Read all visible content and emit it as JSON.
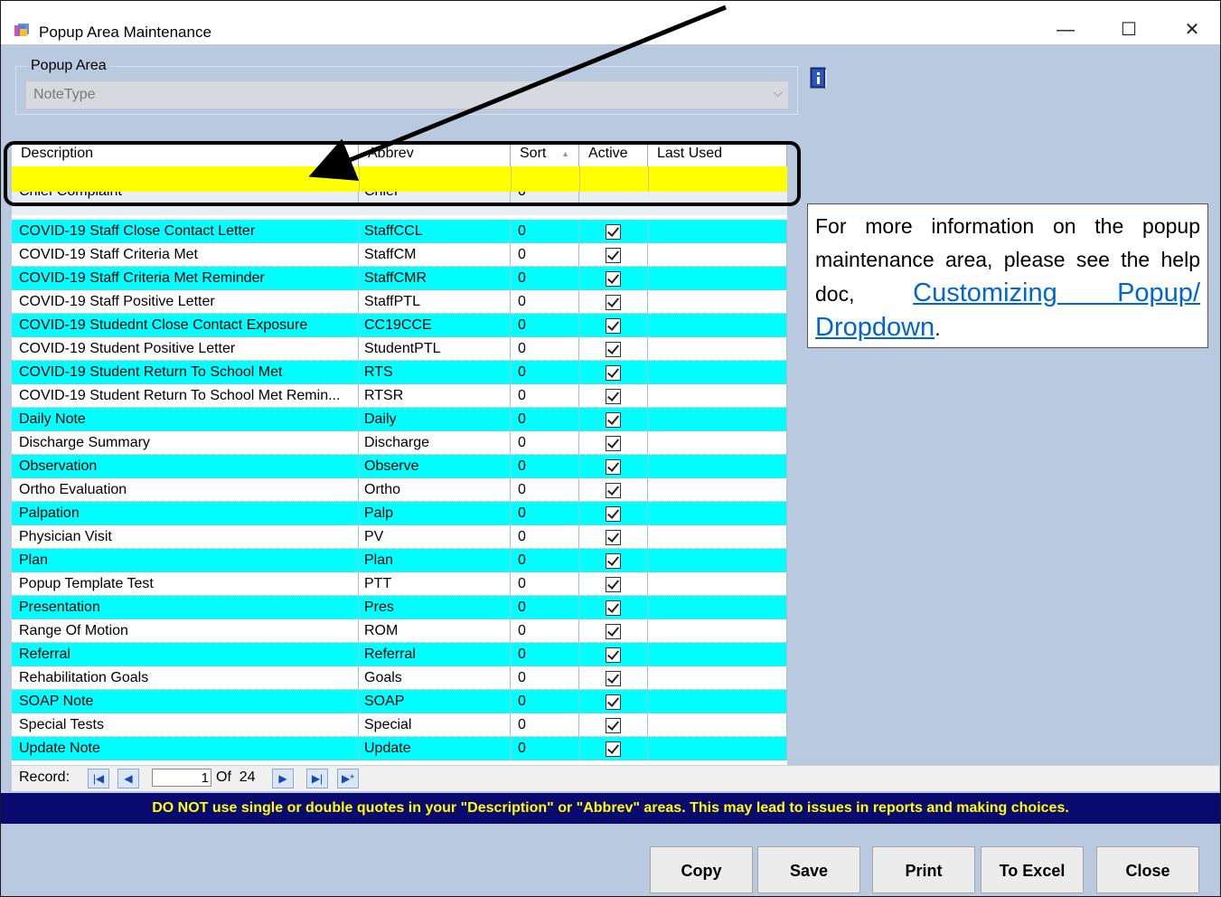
{
  "window": {
    "title": "Popup Area Maintenance",
    "minimize": "—",
    "maximize": "☐",
    "close": "✕"
  },
  "popup_area": {
    "label": "Popup Area",
    "value": "NoteType"
  },
  "grid": {
    "headers": {
      "description": "Description",
      "abbrev": "Abbrev",
      "sort": "Sort",
      "active": "Active",
      "last_used": "Last Used"
    },
    "partial_row": {
      "description": "Chief Complaint",
      "abbrev": "Chief",
      "sort": "0"
    },
    "rows": [
      {
        "description": "COVID-19 Staff Close Contact Letter",
        "abbrev": "StaffCCL",
        "sort": "0"
      },
      {
        "description": "COVID-19 Staff Criteria Met",
        "abbrev": "StaffCM",
        "sort": "0"
      },
      {
        "description": "COVID-19 Staff Criteria Met Reminder",
        "abbrev": "StaffCMR",
        "sort": "0"
      },
      {
        "description": "COVID-19 Staff Positive Letter",
        "abbrev": "StaffPTL",
        "sort": "0"
      },
      {
        "description": "COVID-19 Studednt Close Contact Exposure",
        "abbrev": "CC19CCE",
        "sort": "0"
      },
      {
        "description": "COVID-19 Student Positive Letter",
        "abbrev": "StudentPTL",
        "sort": "0"
      },
      {
        "description": "COVID-19 Student Return To School Met",
        "abbrev": "RTS",
        "sort": "0"
      },
      {
        "description": "COVID-19 Student Return To School Met Remin...",
        "abbrev": "RTSR",
        "sort": "0"
      },
      {
        "description": "Daily Note",
        "abbrev": "Daily",
        "sort": "0"
      },
      {
        "description": "Discharge Summary",
        "abbrev": "Discharge",
        "sort": "0"
      },
      {
        "description": "Observation",
        "abbrev": "Observe",
        "sort": "0"
      },
      {
        "description": "Ortho Evaluation",
        "abbrev": "Ortho",
        "sort": "0"
      },
      {
        "description": "Palpation",
        "abbrev": "Palp",
        "sort": "0"
      },
      {
        "description": "Physician Visit",
        "abbrev": "PV",
        "sort": "0"
      },
      {
        "description": "Plan",
        "abbrev": "Plan",
        "sort": "0"
      },
      {
        "description": "Popup Template Test",
        "abbrev": "PTT",
        "sort": "0"
      },
      {
        "description": "Presentation",
        "abbrev": "Pres",
        "sort": "0"
      },
      {
        "description": "Range Of Motion",
        "abbrev": "ROM",
        "sort": "0"
      },
      {
        "description": "Referral",
        "abbrev": "Referral",
        "sort": "0"
      },
      {
        "description": "Rehabilitation Goals",
        "abbrev": "Goals",
        "sort": "0"
      },
      {
        "description": "SOAP Note",
        "abbrev": "SOAP",
        "sort": "0"
      },
      {
        "description": "Special Tests",
        "abbrev": "Special",
        "sort": "0"
      },
      {
        "description": "Update Note",
        "abbrev": "Update",
        "sort": "0"
      }
    ]
  },
  "navigator": {
    "label": "Record:",
    "current": "1",
    "of": "Of",
    "total": "24"
  },
  "warning": "DO NOT use single or double quotes in your \"Description\" or \"Abbrev\" areas.  This may lead to issues in reports and making choices.",
  "buttons": {
    "copy": "Copy",
    "save": "Save",
    "print": "Print",
    "excel": "To Excel",
    "close": "Close"
  },
  "info_box": {
    "text": "For more information on the popup maintenance area, please see the help doc, ",
    "link": "Customizing Popup/ Dropdown",
    "end": "."
  },
  "colors": {
    "row_alt": "#00ffff",
    "filter_row": "#ffff00",
    "warning_bg": "#0a0a6e",
    "warning_text": "#ffff00",
    "window_bg": "#b9c9e0"
  }
}
